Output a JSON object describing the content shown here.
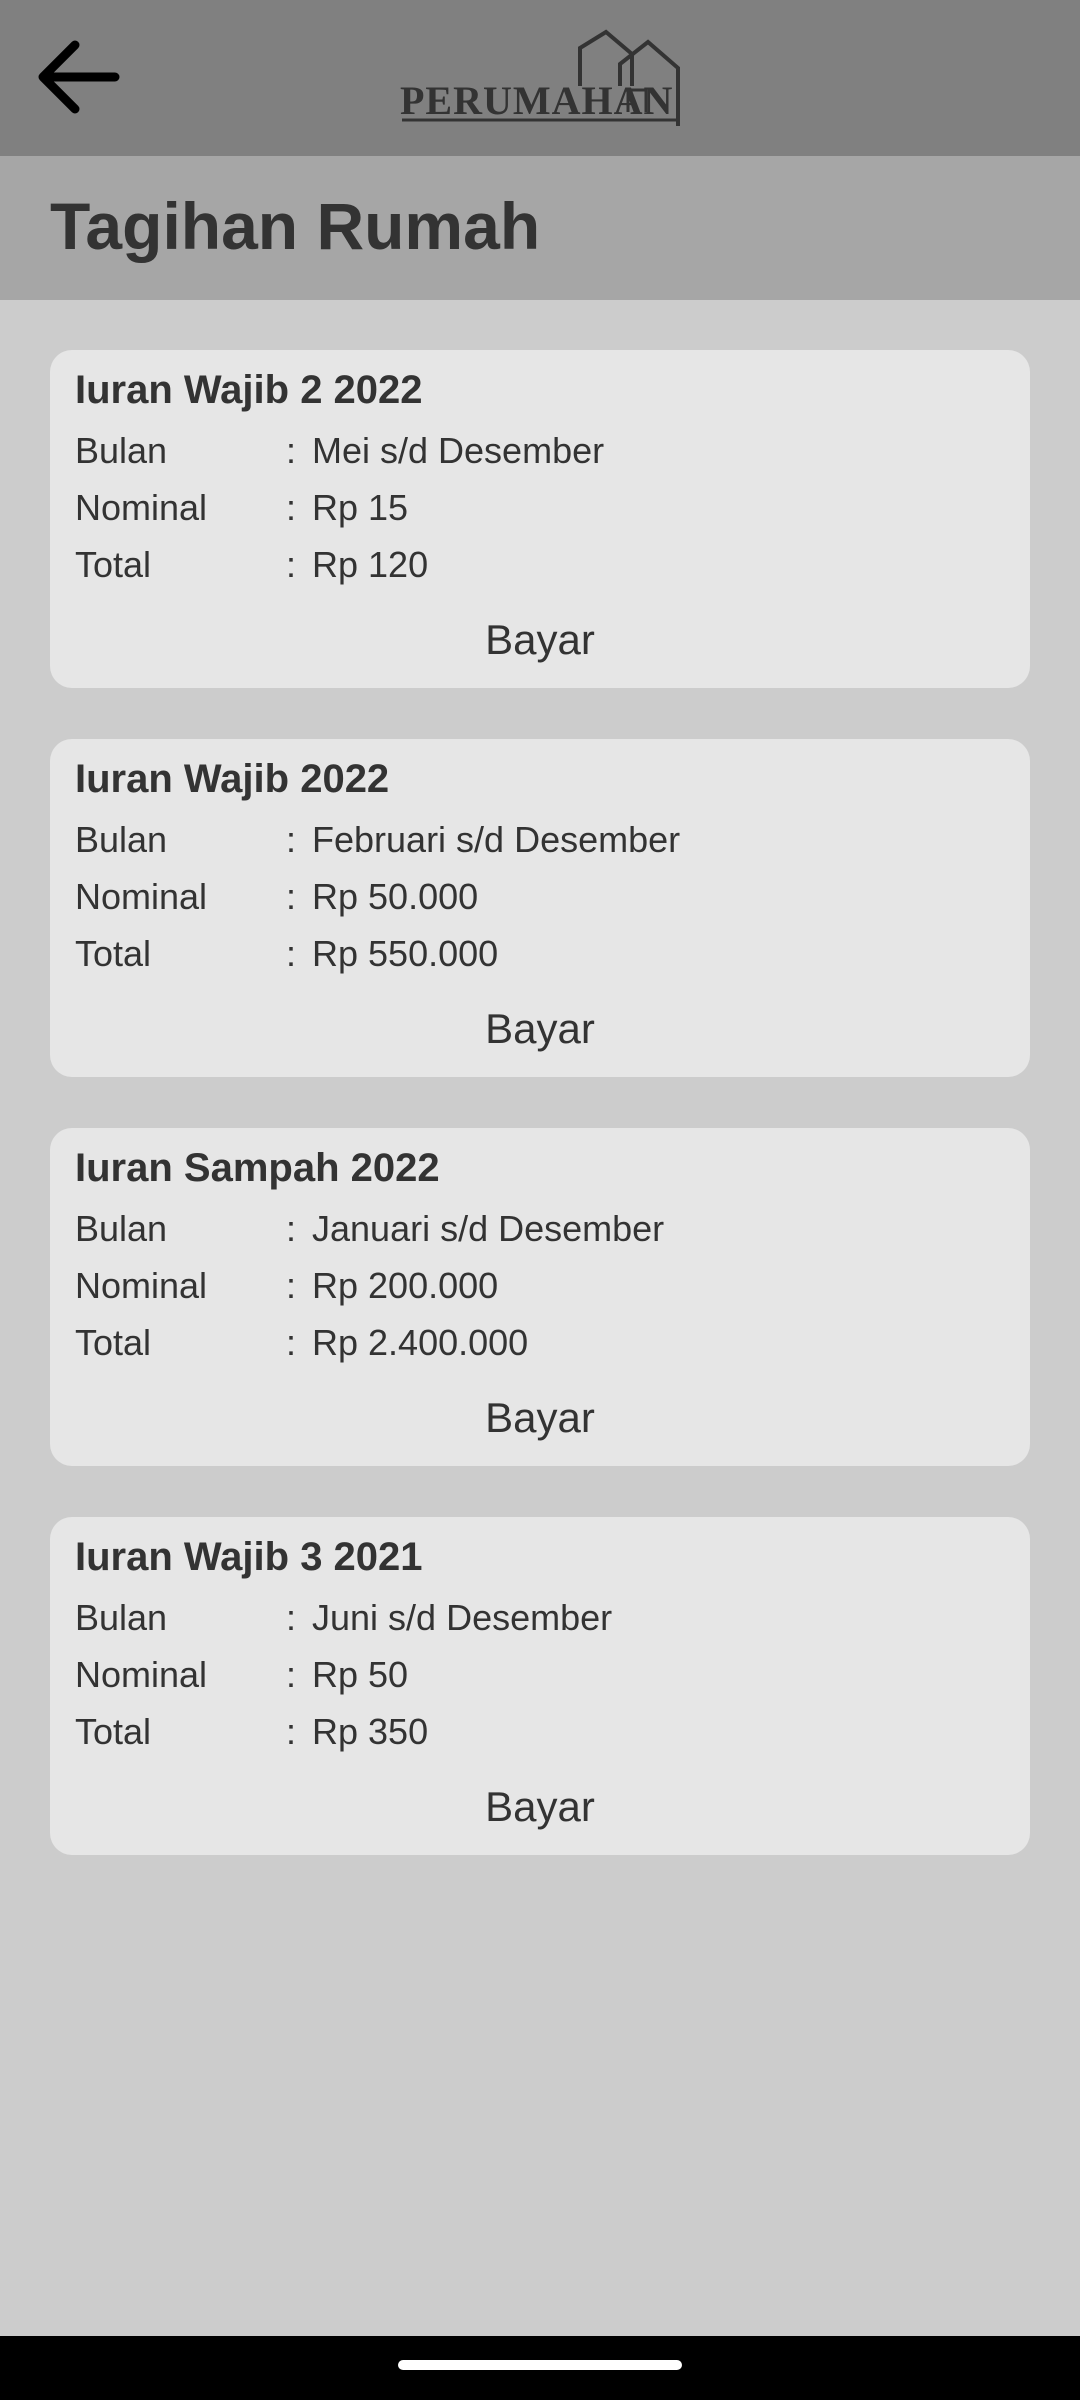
{
  "header": {
    "logo_text": "PERUMAHAN",
    "back_icon": "arrow-left-icon",
    "logo_icon": "house-icon"
  },
  "page": {
    "title": "Tagihan Rumah"
  },
  "labels": {
    "month": "Bulan",
    "nominal": "Nominal",
    "total": "Total",
    "colon": ":",
    "pay": "Bayar"
  },
  "bills": [
    {
      "title": "Iuran Wajib 2 2022",
      "period": "Mei s/d Desember",
      "nominal": "Rp 15",
      "total": "Rp 120"
    },
    {
      "title": "Iuran Wajib 2022",
      "period": "Februari s/d Desember",
      "nominal": "Rp 50.000",
      "total": "Rp 550.000"
    },
    {
      "title": "Iuran Sampah 2022",
      "period": "Januari s/d Desember",
      "nominal": "Rp 200.000",
      "total": "Rp 2.400.000"
    },
    {
      "title": "Iuran Wajib 3 2021",
      "period": "Juni s/d Desember",
      "nominal": "Rp 50",
      "total": "Rp 350"
    }
  ],
  "colors": {
    "app_bar": "#808080",
    "title_bar": "#a6a6a6",
    "background": "#cccccc",
    "card": "#e6e6e6",
    "text": "#333333"
  }
}
